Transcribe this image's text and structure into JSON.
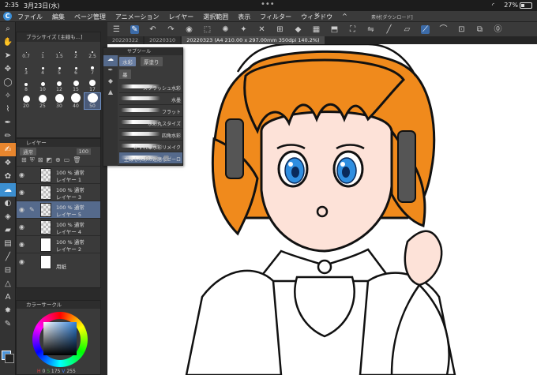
{
  "status": {
    "time": "2:35",
    "date": "3月23日(水)",
    "dots": "•••",
    "wifi": "◜",
    "battery": "27%"
  },
  "menu": {
    "logo": "C",
    "items": [
      "ファイル",
      "編集",
      "ページ管理",
      "アニメーション",
      "レイヤー",
      "選択範囲",
      "表示",
      "フィルター",
      "ウィンドウ",
      "^"
    ],
    "close": "✕",
    "file_title": "素材[ダウンロード]"
  },
  "tabs": [
    {
      "label": "20220322",
      "active": false
    },
    {
      "label": "20220310",
      "active": false
    },
    {
      "label": "20220323 (A4 210.00 x 297.00mm 350dpi 140.2%)",
      "active": true
    }
  ],
  "brush_panel": {
    "title": "ブラシサイズ [主線も...]",
    "sizes": [
      {
        "label": "0.7",
        "d": 1
      },
      {
        "label": "1",
        "d": 1
      },
      {
        "label": "1.5",
        "d": 1
      },
      {
        "label": "2",
        "d": 2
      },
      {
        "label": "2.5",
        "d": 2
      },
      {
        "label": "3",
        "d": 2
      },
      {
        "label": "4",
        "d": 3
      },
      {
        "label": "5",
        "d": 3
      },
      {
        "label": "6",
        "d": 3
      },
      {
        "label": "7",
        "d": 4
      },
      {
        "label": "8",
        "d": 4
      },
      {
        "label": "10",
        "d": 5
      },
      {
        "label": "12",
        "d": 6
      },
      {
        "label": "15",
        "d": 7
      },
      {
        "label": "17",
        "d": 8
      },
      {
        "label": "20",
        "d": 9
      },
      {
        "label": "25",
        "d": 10
      },
      {
        "label": "30",
        "d": 11
      },
      {
        "label": "40",
        "d": 12
      },
      {
        "label": "50",
        "d": 13
      }
    ],
    "selected_index": 19
  },
  "layer_panel": {
    "title": "レイヤー",
    "mode": "通常",
    "opacity": "100",
    "layers": [
      {
        "pct": "100 % 通常",
        "name": "レイヤー 1",
        "thumb": "checker"
      },
      {
        "pct": "100 % 通常",
        "name": "レイヤー 3",
        "thumb": "checker"
      },
      {
        "pct": "100 % 通常",
        "name": "レイヤー 5",
        "thumb": "checker",
        "selected": true
      },
      {
        "pct": "100 % 通常",
        "name": "レイヤー 4",
        "thumb": "checker"
      },
      {
        "pct": "100 % 通常",
        "name": "レイヤー 2",
        "thumb": "white"
      },
      {
        "pct": "",
        "name": "用紙",
        "thumb": "white"
      }
    ]
  },
  "color_panel": {
    "title": "カラーサークル",
    "h_label": "H",
    "h": "0",
    "s_label": "S",
    "s": "175",
    "v_label": "V",
    "v": "255"
  },
  "subtool": {
    "title": "サブツール",
    "groups": [
      {
        "label": "水彩",
        "selected": true
      },
      {
        "label": "厚塗り",
        "selected": false
      }
    ],
    "sub_group": "墨",
    "brushes": [
      {
        "name": "スプラッシュ水彩",
        "selected": false
      },
      {
        "name": "水墨",
        "selected": false
      },
      {
        "name": "フラット",
        "selected": false
      },
      {
        "name": "水彩丸スタイズ",
        "selected": false
      },
      {
        "name": "四角水彩",
        "selected": false
      },
      {
        "name": "かすれ筆水彩リメイク",
        "selected": false
      },
      {
        "name": "主線も水彩の遊磨なゼーロ",
        "selected": true
      }
    ]
  },
  "colors": {
    "hair": "#f08a1c",
    "skin": "#fde2d8",
    "eye": "#2f8ee0",
    "accent_orange": "#e8862e",
    "accent_blue": "#3c8fd0"
  }
}
